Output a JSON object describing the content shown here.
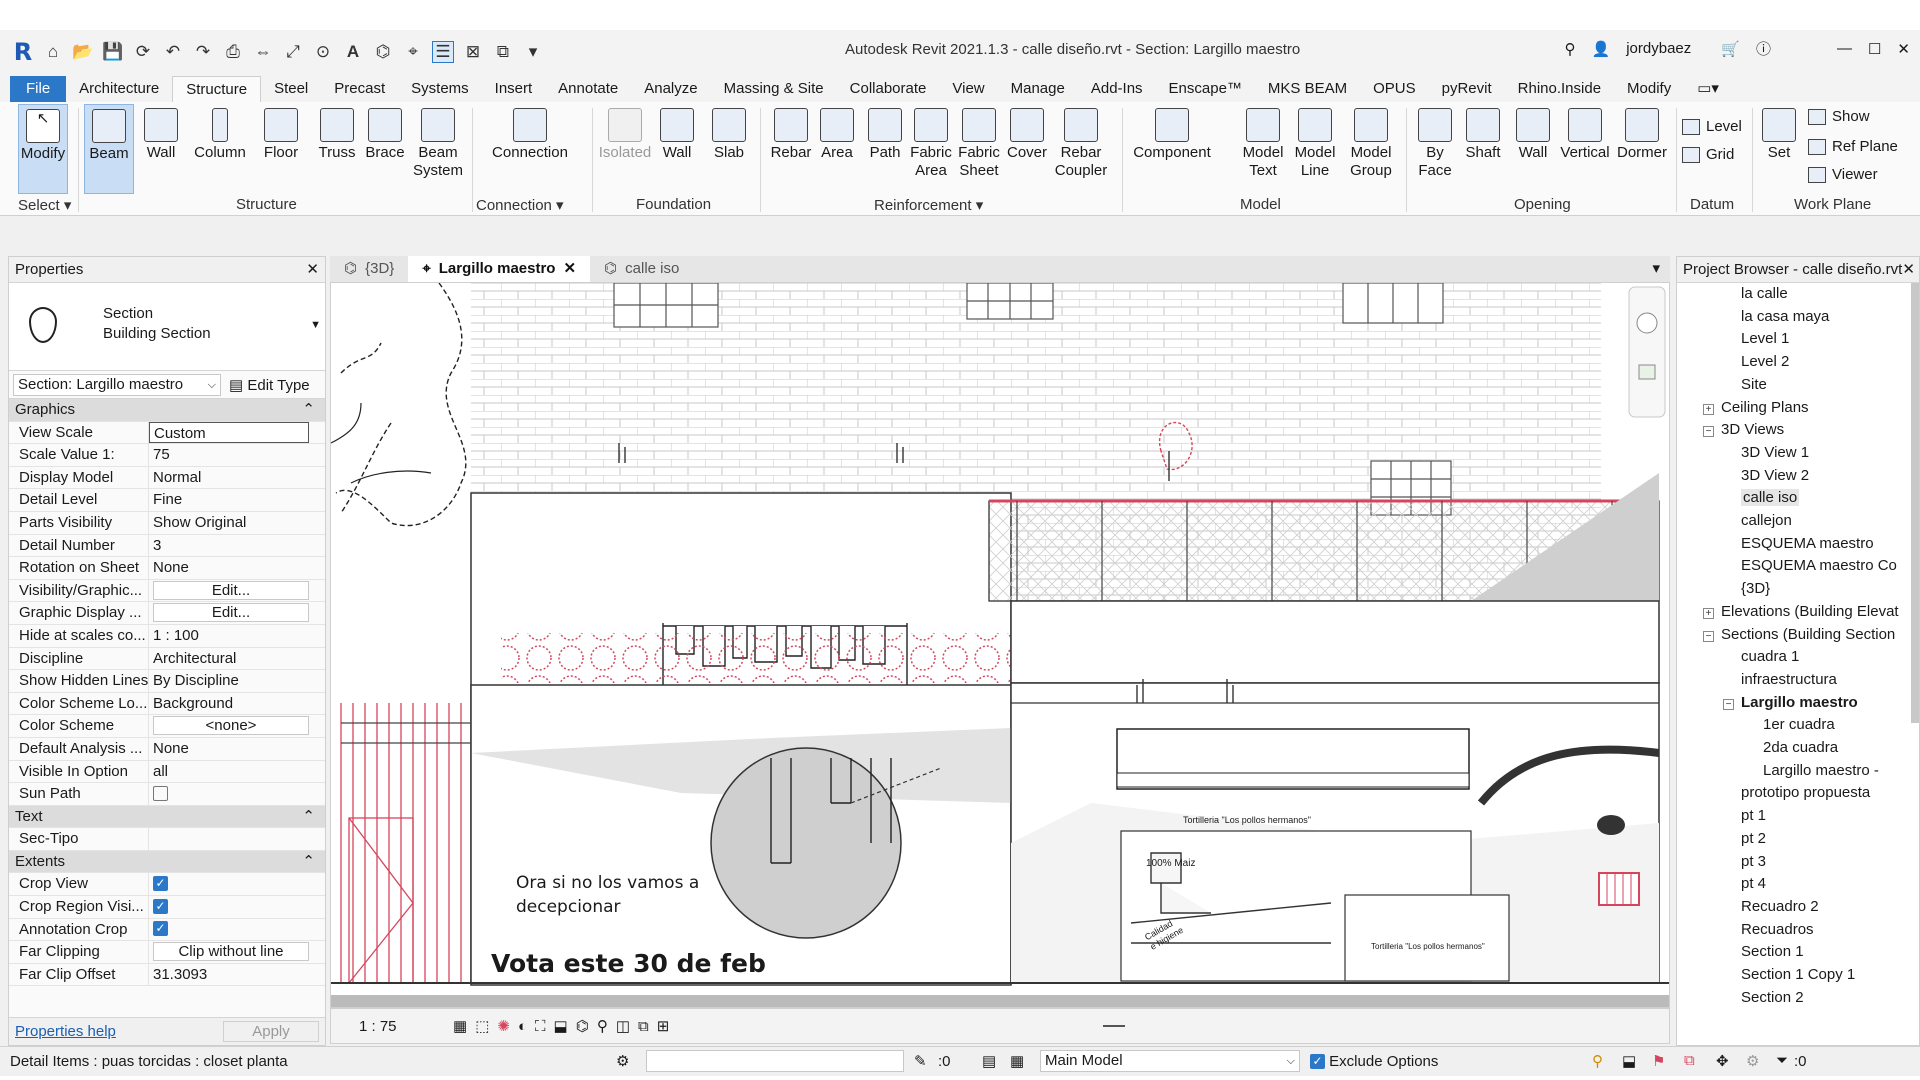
{
  "window": {
    "title": "Autodesk Revit 2021.1.3 - calle diseño.rvt - Section: Largillo maestro",
    "user": "jordybaez"
  },
  "menu_tabs": [
    "File",
    "Architecture",
    "Structure",
    "Steel",
    "Precast",
    "Systems",
    "Insert",
    "Annotate",
    "Analyze",
    "Massing & Site",
    "Collaborate",
    "View",
    "Manage",
    "Add-Ins",
    "Enscape™",
    "MKS BEAM",
    "OPUS",
    "pyRevit",
    "Rhino.Inside",
    "Modify"
  ],
  "active_tab": "Structure",
  "ribbon": {
    "select": {
      "modify": "Modify",
      "group": "Select ▾"
    },
    "structure": {
      "beam": "Beam",
      "wall": "Wall",
      "column": "Column",
      "floor": "Floor",
      "truss": "Truss",
      "brace": "Brace",
      "beam_system_1": "Beam",
      "beam_system_2": "System",
      "group": "Structure"
    },
    "connection": {
      "connection": "Connection",
      "group": "Connection ▾"
    },
    "foundation": {
      "isolated": "Isolated",
      "wall": "Wall",
      "slab": "Slab",
      "group": "Foundation"
    },
    "reinforcement": {
      "rebar": "Rebar",
      "area": "Area",
      "path": "Path",
      "fabric_area_1": "Fabric",
      "fabric_area_2": "Area",
      "fabric_sheet_1": "Fabric",
      "fabric_sheet_2": "Sheet",
      "cover": "Cover",
      "rebar_coupler_1": "Rebar",
      "rebar_coupler_2": "Coupler",
      "group": "Reinforcement ▾"
    },
    "model": {
      "component": "Component",
      "model_text_1": "Model",
      "model_text_2": "Text",
      "model_line_1": "Model",
      "model_line_2": "Line",
      "model_group_1": "Model",
      "model_group_2": "Group",
      "group": "Model"
    },
    "opening": {
      "by_face_1": "By",
      "by_face_2": "Face",
      "shaft": "Shaft",
      "wall": "Wall",
      "vertical": "Vertical",
      "dormer": "Dormer",
      "group": "Opening"
    },
    "datum": {
      "level": "Level",
      "grid": "Grid",
      "group": "Datum"
    },
    "work_plane": {
      "set": "Set",
      "show": "Show",
      "ref_plane": "Ref  Plane",
      "viewer": "Viewer",
      "group": "Work Plane"
    }
  },
  "properties": {
    "header": "Properties",
    "type_line1": "Section",
    "type_line2": "Building Section",
    "instance_selector": "Section: Largillo maestro",
    "edit_type": "Edit Type",
    "graphics_header": "Graphics",
    "rows_graphics": [
      {
        "k": "View Scale",
        "v": "Custom"
      },
      {
        "k": "Scale Value    1:",
        "v": "75"
      },
      {
        "k": "Display Model",
        "v": "Normal"
      },
      {
        "k": "Detail Level",
        "v": "Fine"
      },
      {
        "k": "Parts Visibility",
        "v": "Show Original"
      },
      {
        "k": "Detail Number",
        "v": "3"
      },
      {
        "k": "Rotation on Sheet",
        "v": "None"
      },
      {
        "k": "Visibility/Graphic...",
        "v": "Edit..."
      },
      {
        "k": "Graphic Display ...",
        "v": "Edit..."
      },
      {
        "k": "Hide at scales co...",
        "v": "1 : 100"
      },
      {
        "k": "Discipline",
        "v": "Architectural"
      },
      {
        "k": "Show Hidden Lines",
        "v": "By Discipline"
      },
      {
        "k": "Color Scheme Lo...",
        "v": "Background"
      },
      {
        "k": "Color Scheme",
        "v": "<none>"
      },
      {
        "k": "Default Analysis ...",
        "v": "None"
      },
      {
        "k": "Visible In Option",
        "v": "all"
      },
      {
        "k": "Sun Path",
        "v": ""
      }
    ],
    "text_header": "Text",
    "rows_text": [
      {
        "k": "Sec-Tipo",
        "v": ""
      }
    ],
    "extents_header": "Extents",
    "rows_extents": [
      {
        "k": "Crop View",
        "v": ""
      },
      {
        "k": "Crop Region Visi...",
        "v": ""
      },
      {
        "k": "Annotation Crop",
        "v": ""
      },
      {
        "k": "Far Clipping",
        "v": "Clip without line"
      },
      {
        "k": "Far Clip Offset",
        "v": "31.3093"
      }
    ],
    "help": "Properties help",
    "apply": "Apply"
  },
  "view_tabs": [
    "{3D}",
    "Largillo maestro",
    "calle iso"
  ],
  "active_view": "Largillo maestro",
  "drawing": {
    "text1": "Ora si no los vamos a",
    "text2": "decepcionar",
    "text3": "Vota este 30 de feb",
    "sign_top": "Tortilleria \"Los pollos hermanos\"",
    "maiz": "100% Maiz",
    "calidad1": "Calidad",
    "calidad2": "e higiene",
    "sign_counter": "Tortilleria \"Los pollos hermanos\""
  },
  "view_bar": {
    "scale": "1 : 75"
  },
  "project_browser": {
    "header": "Project Browser - calle diseño.rvt",
    "items": [
      "la calle",
      "la casa maya",
      "Level 1",
      "Level 2",
      "Site",
      "Ceiling Plans",
      "3D Views",
      "3D View 1",
      "3D View 2",
      "calle iso",
      "callejon",
      "ESQUEMA maestro",
      "ESQUEMA maestro Co",
      "{3D}",
      "Elevations (Building Elevat",
      "Sections (Building Section",
      "cuadra 1",
      "infraestructura",
      "Largillo maestro",
      "1er cuadra",
      "2da cuadra",
      "Largillo maestro -",
      "prototipo propuesta",
      "pt 1",
      "pt 2",
      "pt 3",
      "pt 4",
      "Recuadro 2",
      "Recuadros",
      "Section 1",
      "Section 1 Copy 1",
      "Section 2"
    ]
  },
  "status": {
    "left": "Detail Items : puas torcidas : closet planta",
    "zero1": ":0",
    "model": "Main Model",
    "exclude": "Exclude Options",
    "zero2": ":0"
  }
}
